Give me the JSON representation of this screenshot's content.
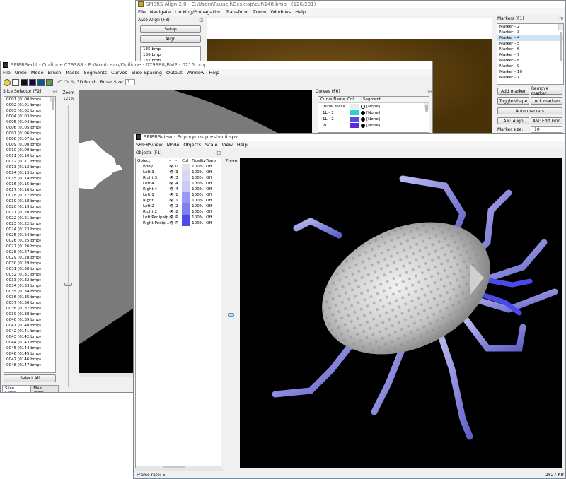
{
  "colors": {
    "accent": "#4a5ae8",
    "fossil": "#d8d8d8",
    "legs": "#8888d8",
    "marker_sel": "#cfe3f7"
  },
  "align": {
    "title": "SPIERS Align 2.0 - C:\\Users\\Russell\\Desktop\\cut\\148.bmp - (126/231)",
    "menu": [
      "File",
      "Navigate",
      "Locking/Propagation",
      "Transform",
      "Zoom",
      "Windows",
      "Help"
    ],
    "auto_align_title": "Auto Align (F3)",
    "setup_label": "Setup",
    "align_label": "Align",
    "files": [
      "135.bmp",
      "136.bmp",
      "137.bmp"
    ],
    "markers_title": "Markers (F1)",
    "markers": [
      "Marker - 2",
      "Marker - 3",
      "Marker - 4",
      "Marker - 5",
      "Marker - 6",
      "Marker - 7",
      "Marker - 8",
      "Marker - 9",
      "Marker - 10",
      "Marker - 11"
    ],
    "selected_marker_index": 2,
    "add_marker": "Add marker",
    "remove_marker": "Remove marker",
    "toggle_shape": "Toggle shape",
    "lock_markers": "Lock markers",
    "auto_markers": "Auto markers",
    "am_align": "AM: Align",
    "am_edit_grid": "AM: Edit Grid",
    "marker_size_label": "Marker size:",
    "marker_size_value": "10"
  },
  "edit": {
    "title": "SPIERSedit - Opilione 079388 - E:/Montceau/Opilione - 079388/BMP - 0215.bmp",
    "menu": [
      "File",
      "Undo",
      "Mode",
      "Brush",
      "Masks",
      "Segments",
      "Curves",
      "Slice Spacing",
      "Output",
      "Window",
      "Help"
    ],
    "brush_label": "3D Brush",
    "brush_size_label": "Brush Size:",
    "brush_size_value": "1",
    "slice_selector_title": "Slice Selector (F2)",
    "slices": [
      "0001 (0100.bmp)",
      "0002 (0101.bmp)",
      "0003 (0102.bmp)",
      "0004 (0103.bmp)",
      "0005 (0104.bmp)",
      "0006 (0105.bmp)",
      "0007 (0106.bmp)",
      "0008 (0107.bmp)",
      "0009 (0108.bmp)",
      "0010 (0109.bmp)",
      "0011 (0110.bmp)",
      "0012 (0111.bmp)",
      "0013 (0112.bmp)",
      "0014 (0113.bmp)",
      "0015 (0114.bmp)",
      "0016 (0115.bmp)",
      "0017 (0116.bmp)",
      "0018 (0117.bmp)",
      "0019 (0118.bmp)",
      "0020 (0119.bmp)",
      "0021 (0120.bmp)",
      "0022 (0121.bmp)",
      "0023 (0122.bmp)",
      "0024 (0123.bmp)",
      "0025 (0124.bmp)",
      "0026 (0125.bmp)",
      "0027 (0126.bmp)",
      "0028 (0127.bmp)",
      "0029 (0128.bmp)",
      "0030 (0129.bmp)",
      "0031 (0130.bmp)",
      "0032 (0131.bmp)",
      "0033 (0132.bmp)",
      "0034 (0133.bmp)",
      "0035 (0134.bmp)",
      "0036 (0135.bmp)",
      "0037 (0136.bmp)",
      "0038 (0137.bmp)",
      "0039 (0138.bmp)",
      "0040 (0139.bmp)",
      "0041 (0140.bmp)",
      "0042 (0141.bmp)",
      "0043 (0142.bmp)",
      "0044 (0143.bmp)",
      "0045 (0144.bmp)",
      "0046 (0145.bmp)",
      "0047 (0146.bmp)",
      "0048 (0147.bmp)"
    ],
    "select_all": "Select All",
    "bottom_tabs": [
      "Slice Selec...",
      "Main Toolb..."
    ],
    "zoom_label": "Zoom",
    "zoom_value": "121%",
    "curves_title": "Curves (F6)",
    "curve_headers": [
      "Curve Name",
      "Col",
      "Segment"
    ],
    "curves": [
      {
        "name": "Initial fossil",
        "color": "#e0f0f0",
        "segment": "[None]"
      },
      {
        "name": "1L - 1",
        "color": "#30d0d0",
        "segment": "[None]"
      },
      {
        "name": "1L - 2",
        "color": "#5050e0",
        "segment": "[None]"
      },
      {
        "name": "2L",
        "color": "#5a2ae0",
        "segment": "[None]"
      }
    ]
  },
  "view": {
    "title": "SPIERSview - Eophrynus prestvicii.spv",
    "menu": [
      "SPIERSview",
      "Mode",
      "Objects",
      "Scale",
      "View",
      "Help"
    ],
    "objects_title": "Objects (F1)",
    "headers": [
      "Object",
      "-",
      "-",
      "Col",
      "Fidelity",
      "Trans"
    ],
    "objects": [
      {
        "name": "Body",
        "n": "0",
        "color": "#e4e4e4",
        "fidelity": "100%",
        "trans": "Off"
      },
      {
        "name": "Left 3",
        "n": "3",
        "color": "#d8d8f4",
        "fidelity": "100%",
        "trans": "Off"
      },
      {
        "name": "Right 3",
        "n": "3",
        "color": "#d8d8f4",
        "fidelity": "100%",
        "trans": "Off"
      },
      {
        "name": "Left 4",
        "n": "4",
        "color": "#cacaf2",
        "fidelity": "100%",
        "trans": "Off"
      },
      {
        "name": "Right 4",
        "n": "4",
        "color": "#cacaf2",
        "fidelity": "100%",
        "trans": "Off"
      },
      {
        "name": "Left 1",
        "n": "1",
        "color": "#9a9af0",
        "fidelity": "100%",
        "trans": "Off"
      },
      {
        "name": "Right 1",
        "n": "1",
        "color": "#9a9af0",
        "fidelity": "100%",
        "trans": "Off"
      },
      {
        "name": "Left 2",
        "n": "2",
        "color": "#8080ec",
        "fidelity": "100%",
        "trans": "Off"
      },
      {
        "name": "Right 2",
        "n": "2",
        "color": "#8080ec",
        "fidelity": "100%",
        "trans": "Off"
      },
      {
        "name": "Left Pedipalp",
        "n": "P",
        "color": "#4a4ae8",
        "fidelity": "100%",
        "trans": "Off"
      },
      {
        "name": "Right Pedip...",
        "n": "P",
        "color": "#4a4ae8",
        "fidelity": "100%",
        "trans": "Off"
      }
    ],
    "zoom_label": "Zoom",
    "frame_rate": "Frame rate: 5",
    "ktr": "2827 KTr"
  }
}
